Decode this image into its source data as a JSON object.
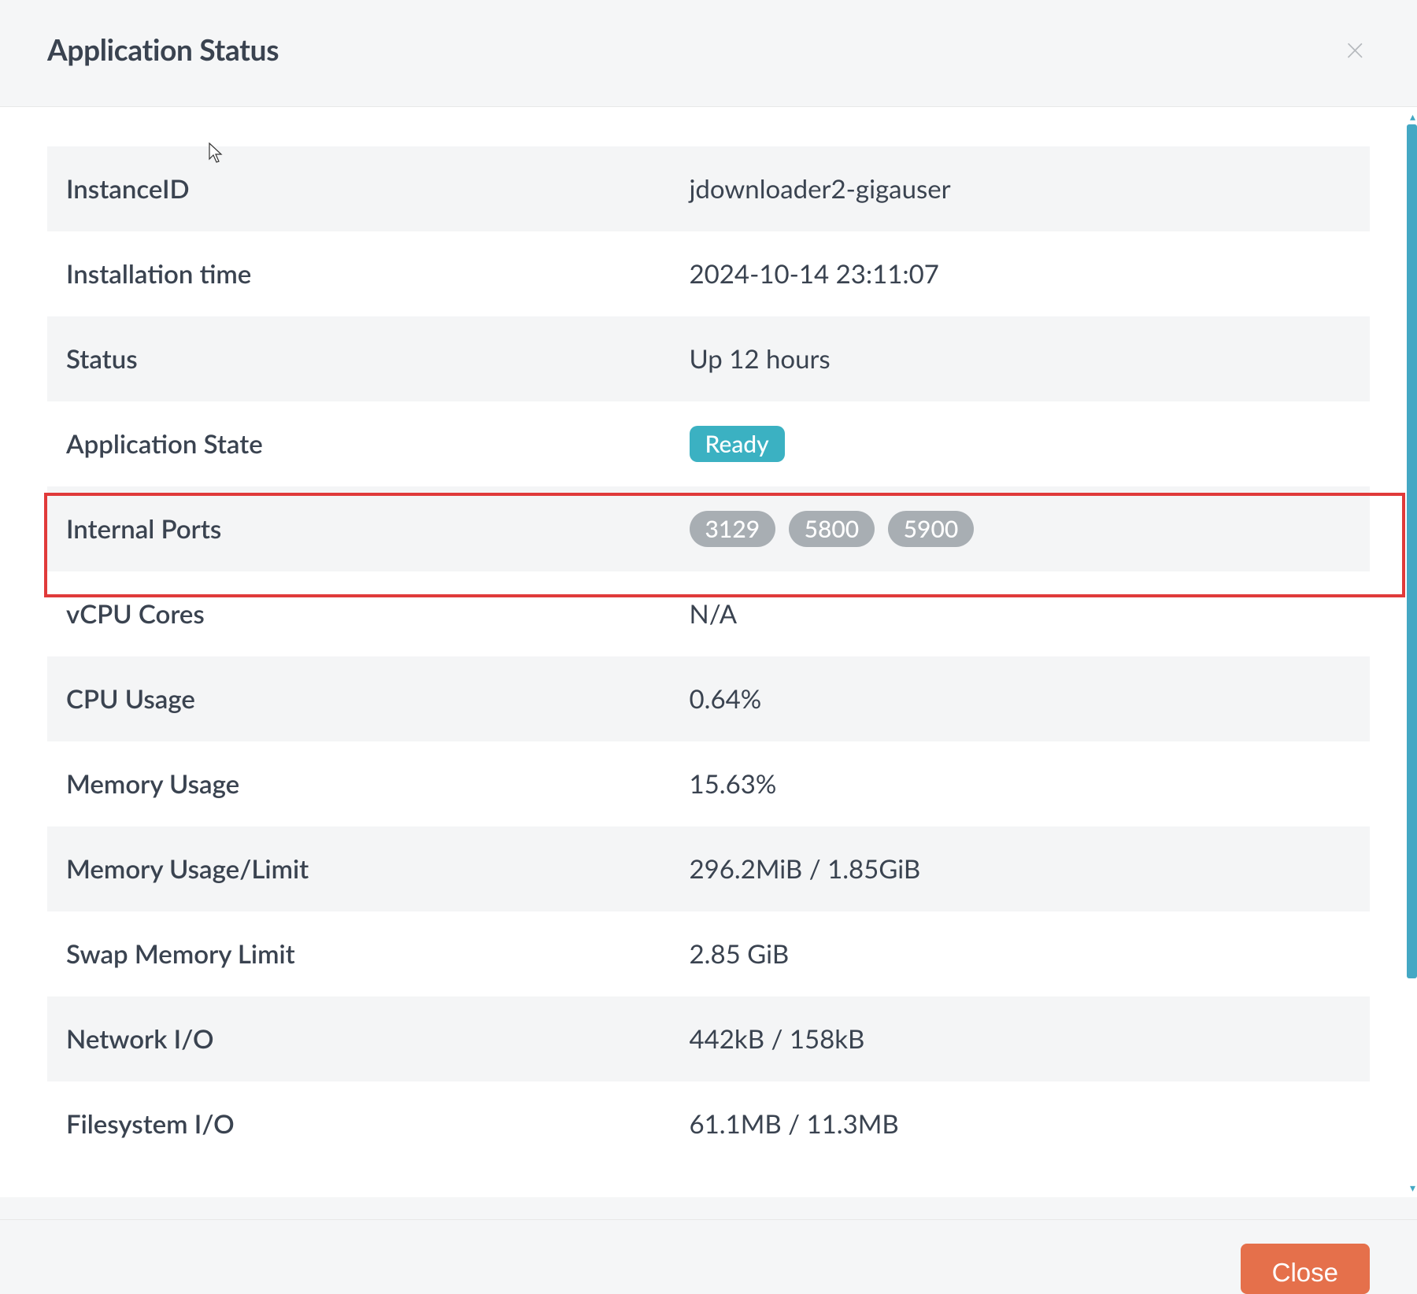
{
  "modal": {
    "title": "Application Status",
    "close_button_label": "Close"
  },
  "rows": [
    {
      "label": "InstanceID",
      "value": "jdownloader2-gigauser",
      "type": "text"
    },
    {
      "label": "Installation time",
      "value": "2024-10-14 23:11:07",
      "type": "text"
    },
    {
      "label": "Status",
      "value": "Up 12 hours",
      "type": "text"
    },
    {
      "label": "Application State",
      "value": "Ready",
      "type": "badge_state"
    },
    {
      "label": "Internal Ports",
      "ports": [
        "3129",
        "5800",
        "5900"
      ],
      "type": "badge_ports",
      "highlighted": true
    },
    {
      "label": "vCPU Cores",
      "value": "N/A",
      "type": "text"
    },
    {
      "label": "CPU Usage",
      "value": "0.64%",
      "type": "text"
    },
    {
      "label": "Memory Usage",
      "value": "15.63%",
      "type": "text"
    },
    {
      "label": "Memory Usage/Limit",
      "value": "296.2MiB / 1.85GiB",
      "type": "text"
    },
    {
      "label": "Swap Memory Limit",
      "value": "2.85 GiB",
      "type": "text"
    },
    {
      "label": "Network I/O",
      "value": "442kB / 158kB",
      "type": "text"
    },
    {
      "label": "Filesystem I/O",
      "value": "61.1MB / 11.3MB",
      "type": "text"
    }
  ]
}
